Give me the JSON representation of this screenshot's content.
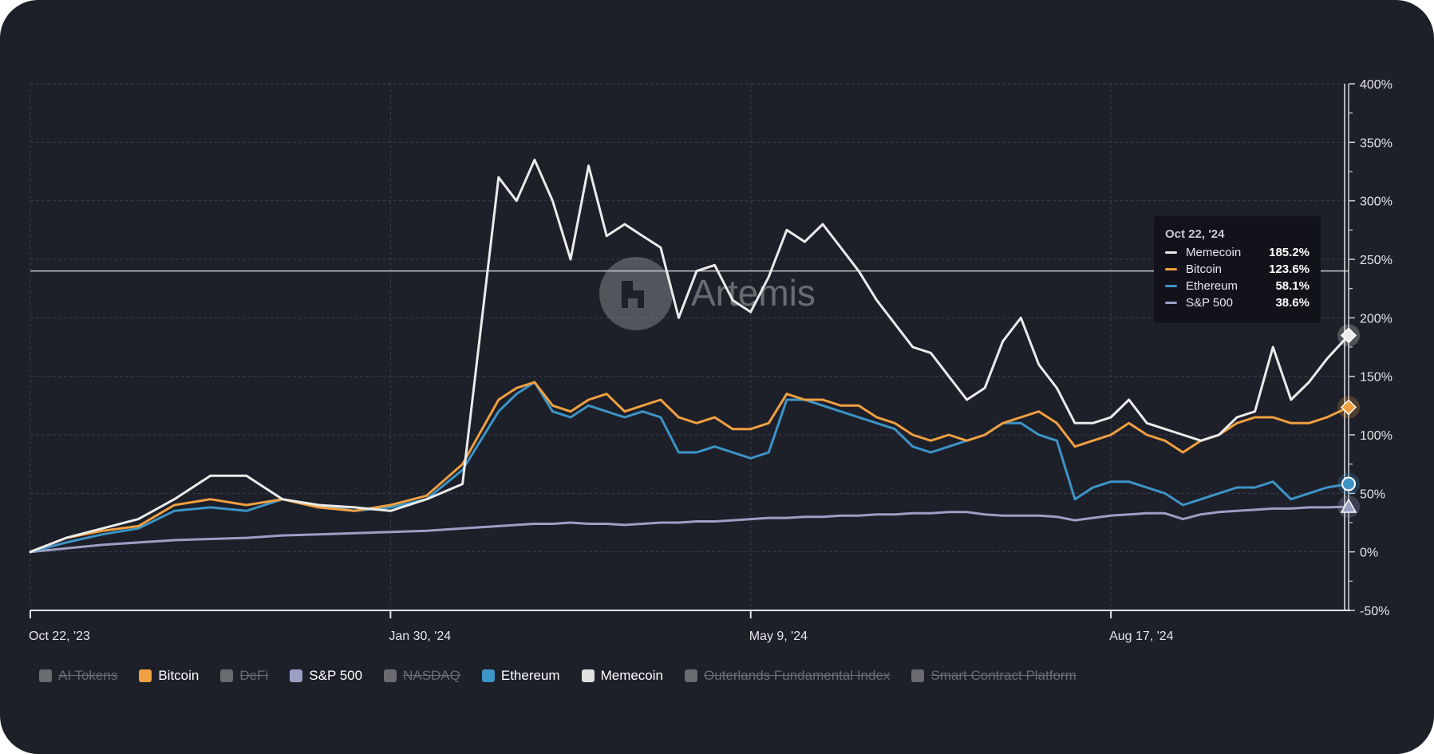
{
  "watermark": "Artemis",
  "tooltip": {
    "date": "Oct 22, '24",
    "rows": [
      {
        "name": "Memecoin",
        "value": "185.2%",
        "color": "#ebebeb"
      },
      {
        "name": "Bitcoin",
        "value": "123.6%",
        "color": "#f0a040"
      },
      {
        "name": "Ethereum",
        "value": "58.1%",
        "color": "#3d94c6"
      },
      {
        "name": "S&P 500",
        "value": "38.6%",
        "color": "#9c9fc4"
      }
    ]
  },
  "legend": [
    {
      "label": "AI Tokens",
      "active": false,
      "color": "#6a6b70"
    },
    {
      "label": "Bitcoin",
      "active": true,
      "color": "#f0a040"
    },
    {
      "label": "DeFi",
      "active": false,
      "color": "#6a6b70"
    },
    {
      "label": "S&P 500",
      "active": true,
      "color": "#9c9fc4"
    },
    {
      "label": "NASDAQ",
      "active": false,
      "color": "#6a6b70"
    },
    {
      "label": "Ethereum",
      "active": true,
      "color": "#3d94c6"
    },
    {
      "label": "Memecoin",
      "active": true,
      "color": "#e0e0e0"
    },
    {
      "label": "Outerlands Fundamental Index",
      "active": false,
      "color": "#6a6b70"
    },
    {
      "label": "Smart Contract Platform",
      "active": false,
      "color": "#6a6b70"
    }
  ],
  "chart_data": {
    "type": "line",
    "x_start": "2023-10-22",
    "x_end": "2024-10-22",
    "xticks": [
      "Oct 22, '23",
      "Jan 30, '24",
      "May 9, '24",
      "Aug 17, '24"
    ],
    "yticks": [
      "400%",
      "350%",
      "300%",
      "250%",
      "200%",
      "150%",
      "100%",
      "50%",
      "0%",
      "-50%"
    ],
    "ylim": [
      -50,
      400
    ],
    "y_unit": "%",
    "crosshair_y": 240,
    "grid": true,
    "legend_position": "bottom-left",
    "x": [
      "2023-10-22",
      "2023-11-01",
      "2023-11-11",
      "2023-11-21",
      "2023-12-01",
      "2023-12-11",
      "2023-12-21",
      "2023-12-31",
      "2024-01-10",
      "2024-01-20",
      "2024-01-30",
      "2024-02-09",
      "2024-02-19",
      "2024-02-29",
      "2024-03-05",
      "2024-03-10",
      "2024-03-15",
      "2024-03-20",
      "2024-03-25",
      "2024-03-30",
      "2024-04-04",
      "2024-04-09",
      "2024-04-14",
      "2024-04-19",
      "2024-04-24",
      "2024-04-29",
      "2024-05-04",
      "2024-05-09",
      "2024-05-14",
      "2024-05-19",
      "2024-05-24",
      "2024-05-29",
      "2024-06-03",
      "2024-06-08",
      "2024-06-13",
      "2024-06-18",
      "2024-06-23",
      "2024-06-28",
      "2024-07-03",
      "2024-07-08",
      "2024-07-13",
      "2024-07-18",
      "2024-07-23",
      "2024-07-28",
      "2024-08-02",
      "2024-08-07",
      "2024-08-12",
      "2024-08-17",
      "2024-08-22",
      "2024-08-27",
      "2024-09-01",
      "2024-09-06",
      "2024-09-11",
      "2024-09-16",
      "2024-09-21",
      "2024-09-26",
      "2024-10-01",
      "2024-10-06",
      "2024-10-11",
      "2024-10-16",
      "2024-10-22"
    ],
    "series": [
      {
        "name": "Memecoin",
        "color": "#ebebeb",
        "values": [
          0,
          12,
          20,
          28,
          45,
          65,
          65,
          45,
          40,
          38,
          35,
          45,
          58,
          320,
          300,
          335,
          300,
          250,
          330,
          270,
          280,
          270,
          260,
          200,
          240,
          245,
          215,
          205,
          235,
          275,
          265,
          280,
          260,
          240,
          215,
          195,
          175,
          170,
          150,
          130,
          140,
          180,
          200,
          160,
          140,
          110,
          110,
          115,
          130,
          110,
          105,
          100,
          95,
          100,
          115,
          120,
          175,
          130,
          145,
          165,
          185
        ]
      },
      {
        "name": "Bitcoin",
        "color": "#f0a040",
        "values": [
          0,
          12,
          18,
          22,
          40,
          45,
          40,
          45,
          38,
          35,
          40,
          48,
          75,
          130,
          140,
          145,
          125,
          120,
          130,
          135,
          120,
          125,
          130,
          115,
          110,
          115,
          105,
          105,
          110,
          135,
          130,
          130,
          125,
          125,
          115,
          110,
          100,
          95,
          100,
          95,
          100,
          110,
          115,
          120,
          110,
          90,
          95,
          100,
          110,
          100,
          95,
          85,
          95,
          100,
          110,
          115,
          115,
          110,
          110,
          115,
          123.6
        ]
      },
      {
        "name": "Ethereum",
        "color": "#3d94c6",
        "values": [
          0,
          8,
          15,
          20,
          35,
          38,
          35,
          45,
          40,
          35,
          38,
          45,
          70,
          120,
          135,
          145,
          120,
          115,
          125,
          120,
          115,
          120,
          115,
          85,
          85,
          90,
          85,
          80,
          85,
          130,
          130,
          125,
          120,
          115,
          110,
          105,
          90,
          85,
          90,
          95,
          100,
          110,
          110,
          100,
          95,
          45,
          55,
          60,
          60,
          55,
          50,
          40,
          45,
          50,
          55,
          55,
          60,
          45,
          50,
          55,
          58.1
        ]
      },
      {
        "name": "S&P 500",
        "color": "#9c9fc4",
        "values": [
          0,
          3,
          6,
          8,
          10,
          11,
          12,
          14,
          15,
          16,
          17,
          18,
          20,
          22,
          23,
          24,
          24,
          25,
          24,
          24,
          23,
          24,
          25,
          25,
          26,
          26,
          27,
          28,
          29,
          29,
          30,
          30,
          31,
          31,
          32,
          32,
          33,
          33,
          34,
          34,
          32,
          31,
          31,
          31,
          30,
          27,
          29,
          31,
          32,
          33,
          33,
          28,
          32,
          34,
          35,
          36,
          37,
          37,
          38,
          38,
          38.6
        ]
      }
    ],
    "end_markers": [
      {
        "series": "Memecoin",
        "shape": "diamond"
      },
      {
        "series": "Bitcoin",
        "shape": "diamond"
      },
      {
        "series": "Ethereum",
        "shape": "circle"
      },
      {
        "series": "S&P 500",
        "shape": "triangle"
      }
    ]
  }
}
